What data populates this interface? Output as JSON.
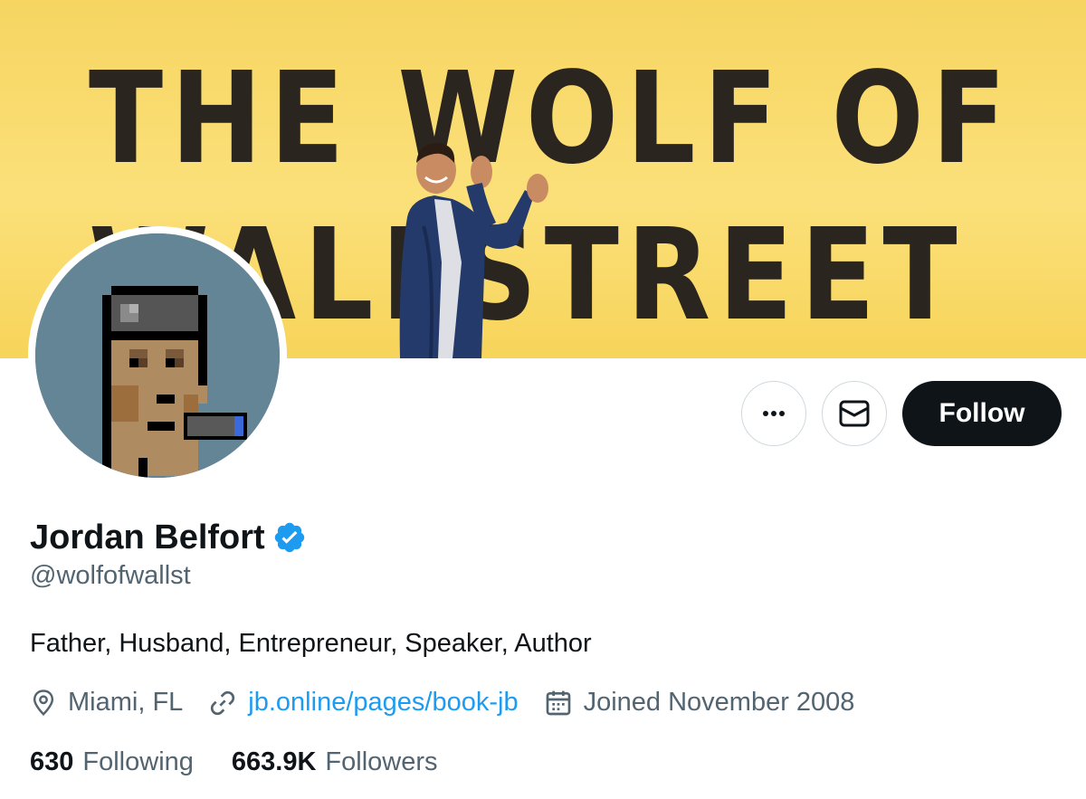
{
  "banner": {
    "line1": "THE WOLF OF",
    "line2": "WALLSTREET"
  },
  "profile": {
    "name": "Jordan Belfort",
    "handle": "@wolfofwallst",
    "bio": "Father, Husband, Entrepreneur, Speaker, Author",
    "location": "Miami, FL",
    "website": "jb.online/pages/book-jb",
    "joined": "Joined November 2008",
    "verified": true
  },
  "actions": {
    "more_icon": "more-icon",
    "message_icon": "envelope-icon",
    "follow_label": "Follow"
  },
  "stats": {
    "following_count": "630",
    "following_label": "Following",
    "followers_count": "663.9K",
    "followers_label": "Followers"
  },
  "colors": {
    "accent": "#1d9bf0",
    "text_primary": "#0f1419",
    "text_secondary": "#536471",
    "banner_yellow": "#f7d85f",
    "avatar_bg": "#648596"
  }
}
